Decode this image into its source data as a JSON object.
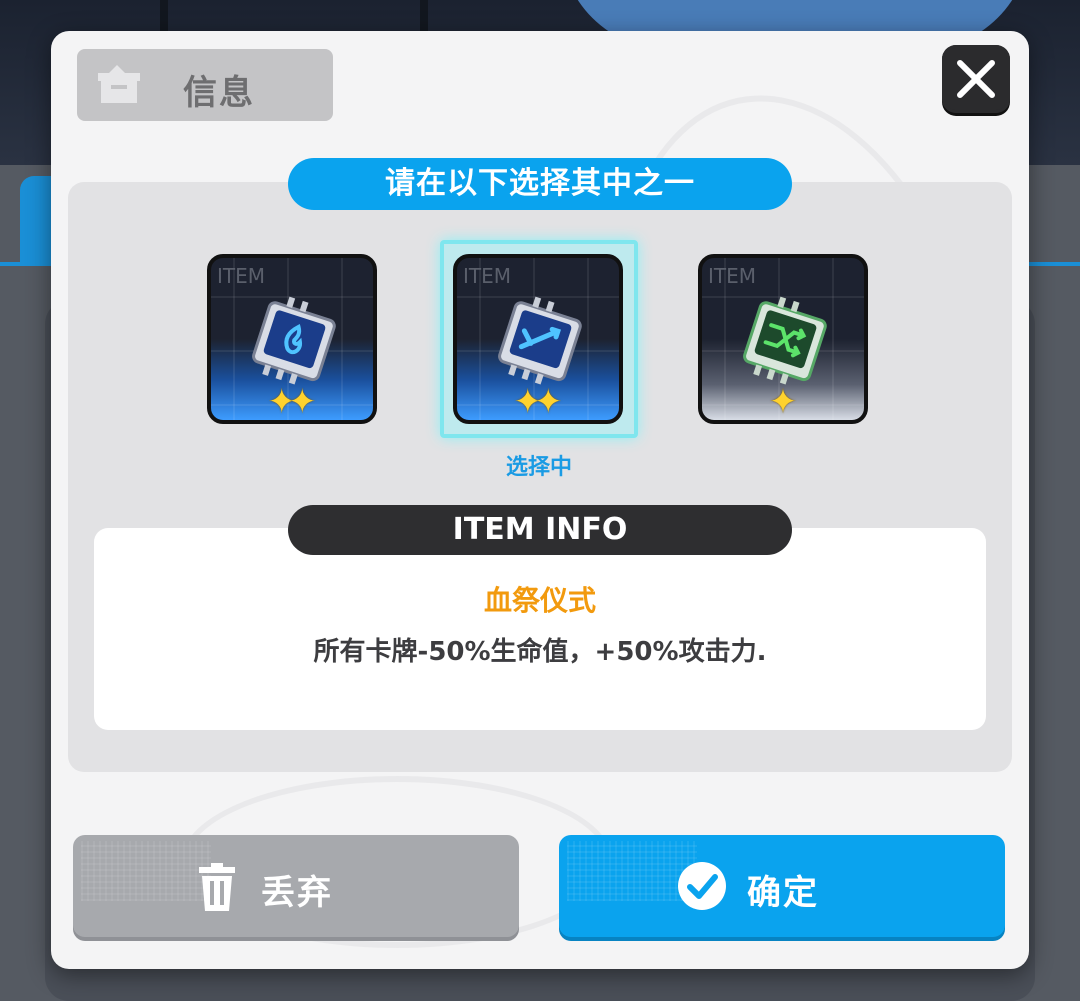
{
  "dialog": {
    "title": "信息",
    "close_icon": "close-icon"
  },
  "selection": {
    "prompt": "请在以下选择其中之一",
    "selected_label": "选择中",
    "items": [
      {
        "label": "ITEM",
        "icon": "chip-flame-icon",
        "color": "#3d9cff",
        "stars": 2,
        "selected": false
      },
      {
        "label": "ITEM",
        "icon": "chip-sword-icon",
        "color": "#3d9cff",
        "stars": 2,
        "selected": true
      },
      {
        "label": "ITEM",
        "icon": "chip-shuffle-icon",
        "color": "#5ce36a",
        "stars": 1,
        "selected": false
      }
    ]
  },
  "info": {
    "header": "ITEM INFO",
    "name": "血祭仪式",
    "description": "所有卡牌-50%生命值，+50%攻击力."
  },
  "buttons": {
    "discard": "丢弃",
    "confirm": "确定"
  },
  "colors": {
    "accent": "#0aa3ee",
    "name_highlight": "#f29a0e",
    "selected_glow": "#7fe6ee"
  }
}
